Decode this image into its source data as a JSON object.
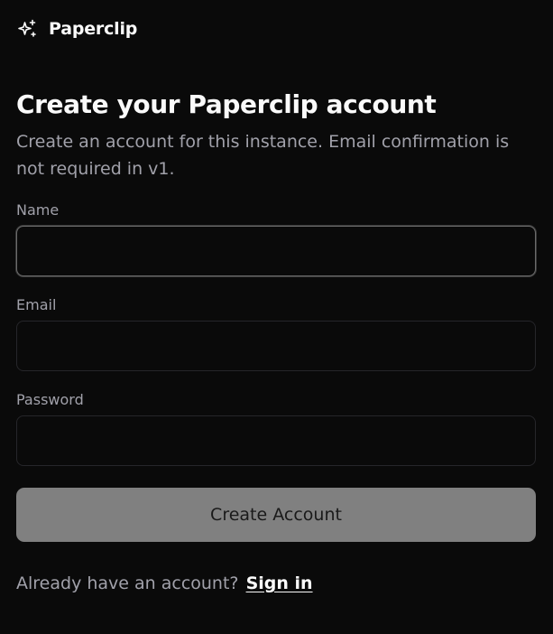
{
  "brand": {
    "name": "Paperclip",
    "icon": "sparkles-icon"
  },
  "header": {
    "title": "Create your Paperclip account",
    "subtitle": "Create an account for this instance. Email confirmation is not required in v1."
  },
  "form": {
    "name": {
      "label": "Name",
      "value": "",
      "focused": true
    },
    "email": {
      "label": "Email",
      "value": ""
    },
    "password": {
      "label": "Password",
      "value": ""
    },
    "submit_label": "Create Account"
  },
  "footer": {
    "prompt": "Already have an account?",
    "link_label": "Sign in"
  },
  "colors": {
    "background": "#0a0a0a",
    "text": "#fafafa",
    "muted": "#a1a1aa",
    "button": "#808080"
  }
}
